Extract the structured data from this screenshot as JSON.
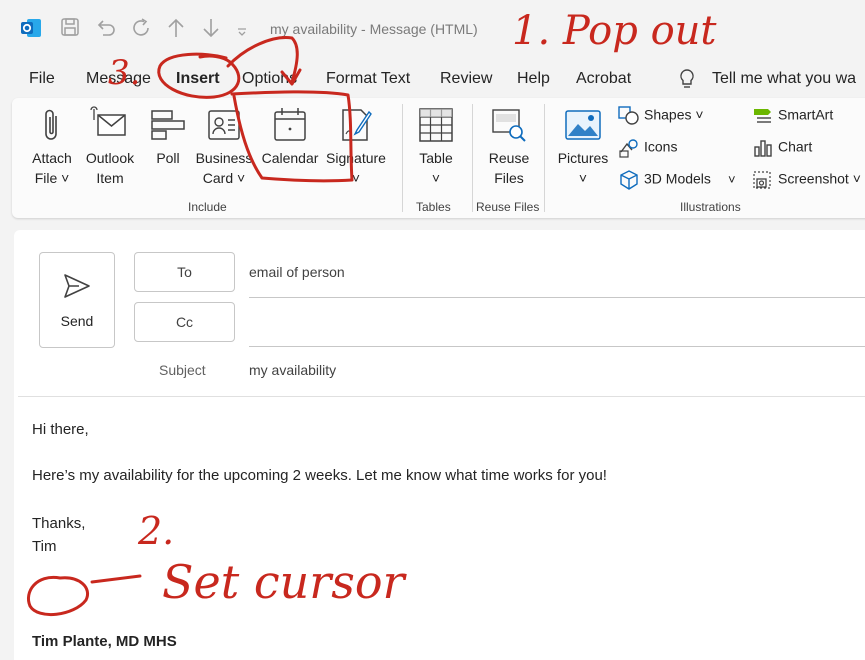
{
  "window": {
    "title": "my availability  -  Message (HTML)"
  },
  "tabs": [
    {
      "label": "File"
    },
    {
      "label": "Message"
    },
    {
      "label": "Insert"
    },
    {
      "label": "Options"
    },
    {
      "label": "Format Text"
    },
    {
      "label": "Review"
    },
    {
      "label": "Help"
    },
    {
      "label": "Acrobat"
    }
  ],
  "tell_me": "Tell me what you wa",
  "ribbon": {
    "include": {
      "label": "Include",
      "attach": [
        "Attach",
        "File ˅"
      ],
      "outlook_item": [
        "Outlook",
        "Item"
      ],
      "poll": "Poll",
      "business_card": [
        "Business",
        "Card ˅"
      ],
      "calendar": "Calendar",
      "signature": [
        "Signature",
        "˅"
      ]
    },
    "tables": {
      "label": "Tables",
      "table": [
        "Table",
        "˅"
      ]
    },
    "reuse": {
      "label": "Reuse Files",
      "reuse": [
        "Reuse",
        "Files"
      ]
    },
    "illustrations": {
      "label": "Illustrations",
      "pictures": [
        "Pictures",
        "˅"
      ],
      "shapes": "Shapes ˅",
      "icons": "Icons",
      "models": "3D Models",
      "models_chev": "˅",
      "smartart": "SmartArt",
      "chart": "Chart",
      "screenshot": "Screenshot ˅"
    }
  },
  "compose": {
    "send": "Send",
    "to_label": "To",
    "to_value": "email of person",
    "cc_label": "Cc",
    "cc_value": "",
    "subject_label": "Subject",
    "subject_value": "my availability"
  },
  "body": {
    "greeting": "Hi there,",
    "line": "Here’s my availability for the upcoming 2 weeks. Let me know what time works for you!",
    "thanks": "Thanks,",
    "name": "Tim",
    "signature": "Tim Plante, MD MHS"
  },
  "annotations": {
    "step1": "1. Pop out",
    "step2": "2.",
    "step2_text": "Set cursor",
    "step3": "3."
  },
  "colors": {
    "accent": "#0f6cbd",
    "annotation": "#c8281e"
  }
}
